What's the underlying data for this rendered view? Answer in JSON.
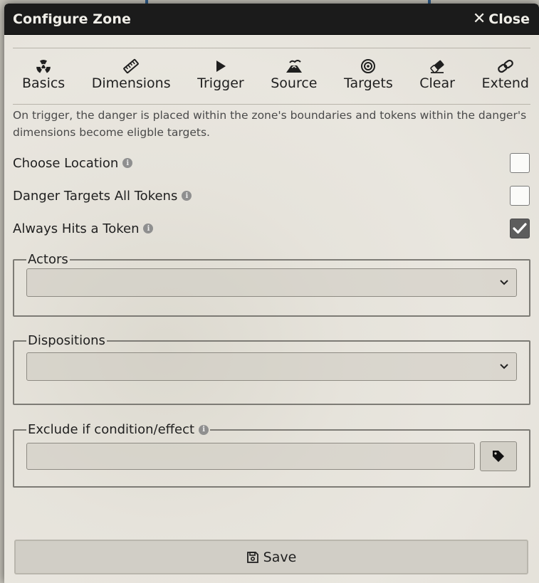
{
  "window": {
    "title": "Configure Zone",
    "close_label": "Close"
  },
  "tabs": [
    {
      "label": "Basics",
      "icon": "radiation-icon"
    },
    {
      "label": "Dimensions",
      "icon": "ruler-icon"
    },
    {
      "label": "Trigger",
      "icon": "play-icon"
    },
    {
      "label": "Source",
      "icon": "volcano-icon"
    },
    {
      "label": "Targets",
      "icon": "bullseye-icon"
    },
    {
      "label": "Clear",
      "icon": "eraser-icon"
    },
    {
      "label": "Extend",
      "icon": "link-icon"
    }
  ],
  "description": "On trigger, the danger is placed within the zone's boundaries and tokens within the danger's dimensions become eligble targets.",
  "options": [
    {
      "label": "Choose Location",
      "checked": false
    },
    {
      "label": "Danger Targets All Tokens",
      "checked": false
    },
    {
      "label": "Always Hits a Token",
      "checked": true
    }
  ],
  "actors": {
    "legend": "Actors",
    "selected": ""
  },
  "dispositions": {
    "legend": "Dispositions",
    "selected": ""
  },
  "exclude": {
    "legend": "Exclude if condition/effect",
    "value": ""
  },
  "save_label": "Save",
  "colors": {
    "titlebar": "#1b1b1b",
    "panel": "#e6e3db",
    "checked": "#5d5d5d"
  }
}
